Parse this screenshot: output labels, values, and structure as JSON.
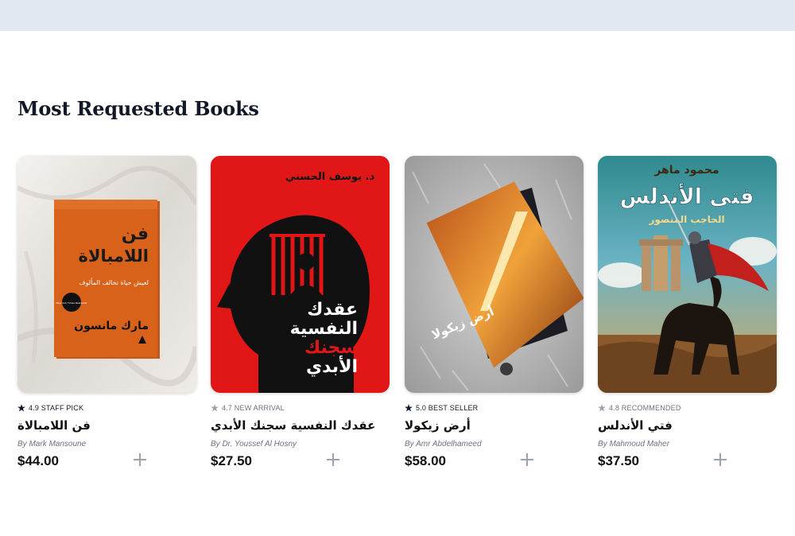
{
  "section": {
    "title": "Most Requested Books"
  },
  "colors": {
    "topbar": "#e2e8f0",
    "star_filled": "#0f172a",
    "star_muted": "#9ca3af",
    "plus": "#9ca3af"
  },
  "books": [
    {
      "rating": "4.9 STAFF PICK",
      "star": "filled",
      "title": "فن اللامبالاة",
      "author": "By Mark Mansoune",
      "price": "$44.00",
      "cover": {
        "title_line1": "فن",
        "title_line2": "اللامبالاة",
        "subtitle": "لعيش حياة تخالف المألوف",
        "author": "مارك مانسون",
        "badge": "New York Times Bestseller"
      }
    },
    {
      "rating": "4.7 NEW ARRIVAL",
      "star": "muted",
      "title": "عقدك النفسية سجنك الأبدي",
      "author": "By Dr. Youssef Al Hosny",
      "price": "$27.50",
      "cover": {
        "author": "د. يوسف الحسني",
        "title_line1": "عقدك",
        "title_line2": "النفسية",
        "title_line3": "سجنك",
        "title_line4": "الأبدي"
      }
    },
    {
      "rating": "5.0 BEST SELLER",
      "star": "filled",
      "title": "أرض زيكولا",
      "author": "By Amr Abdelhameed",
      "price": "$58.00",
      "cover": {
        "title": "أرض زيكولا"
      }
    },
    {
      "rating": "4.8 RECOMMENDED",
      "star": "muted",
      "title": "فتي الأندلس",
      "author": "By Mahmoud Maher",
      "price": "$37.50",
      "cover": {
        "author": "محمود ماهر",
        "title": "فتى الأندلس",
        "subtitle": "الحاجب المنصور"
      }
    }
  ]
}
